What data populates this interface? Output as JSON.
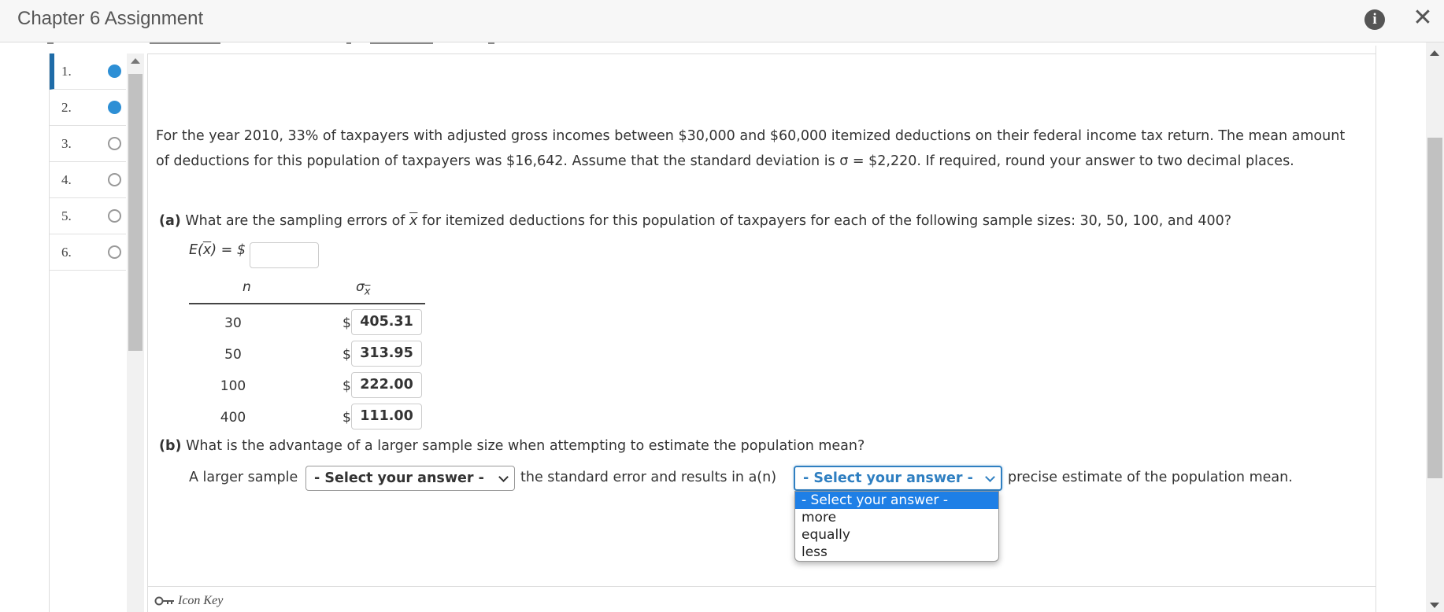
{
  "header": {
    "title": "Chapter 6 Assignment"
  },
  "question_nav": {
    "items": [
      {
        "num": "1.",
        "status": "answered"
      },
      {
        "num": "2.",
        "status": "answered"
      },
      {
        "num": "3.",
        "status": "unanswered"
      },
      {
        "num": "4.",
        "status": "unanswered"
      },
      {
        "num": "5.",
        "status": "unanswered"
      },
      {
        "num": "6.",
        "status": "unanswered"
      }
    ]
  },
  "question": {
    "text": "For the year 2010, 33% of taxpayers with adjusted gross incomes between $30,000 and $60,000 itemized deductions on their federal income tax return. The mean amount of deductions for this population of taxpayers was $16,642. Assume that the standard deviation is σ = $2,220. If required, round your answer to two decimal places.",
    "part_a": {
      "label": "(a)",
      "text_before": " What are the sampling errors of ",
      "xbar": "x",
      "text_after": " for itemized deductions for this population of taxpayers for each of the following sample sizes: 30, 50, 100, and 400?",
      "ex_label_e": "E(",
      "ex_label_x": "x",
      "ex_label_end": ") = $",
      "ex_value": "",
      "table": {
        "col_n": "n",
        "col_sigma": "σ",
        "col_sigma_sub": "x",
        "dollar": "$",
        "rows": [
          {
            "n": "30",
            "value": "405.31"
          },
          {
            "n": "50",
            "value": "313.95"
          },
          {
            "n": "100",
            "value": "222.00"
          },
          {
            "n": "400",
            "value": "111.00"
          }
        ]
      }
    },
    "part_b": {
      "label": "(b)",
      "text": " What is the advantage of a larger sample size when attempting to estimate the population mean?",
      "sentence_start": "A larger sample",
      "select1_value": "- Select your answer -",
      "sentence_middle": "the standard error and results in a(n)",
      "select2_value": "- Select your answer -",
      "sentence_end": "precise estimate of the population mean.",
      "dropdown_options": [
        "- Select your answer -",
        "more",
        "equally",
        "less"
      ]
    }
  },
  "footer": {
    "icon_key": "Icon Key"
  }
}
